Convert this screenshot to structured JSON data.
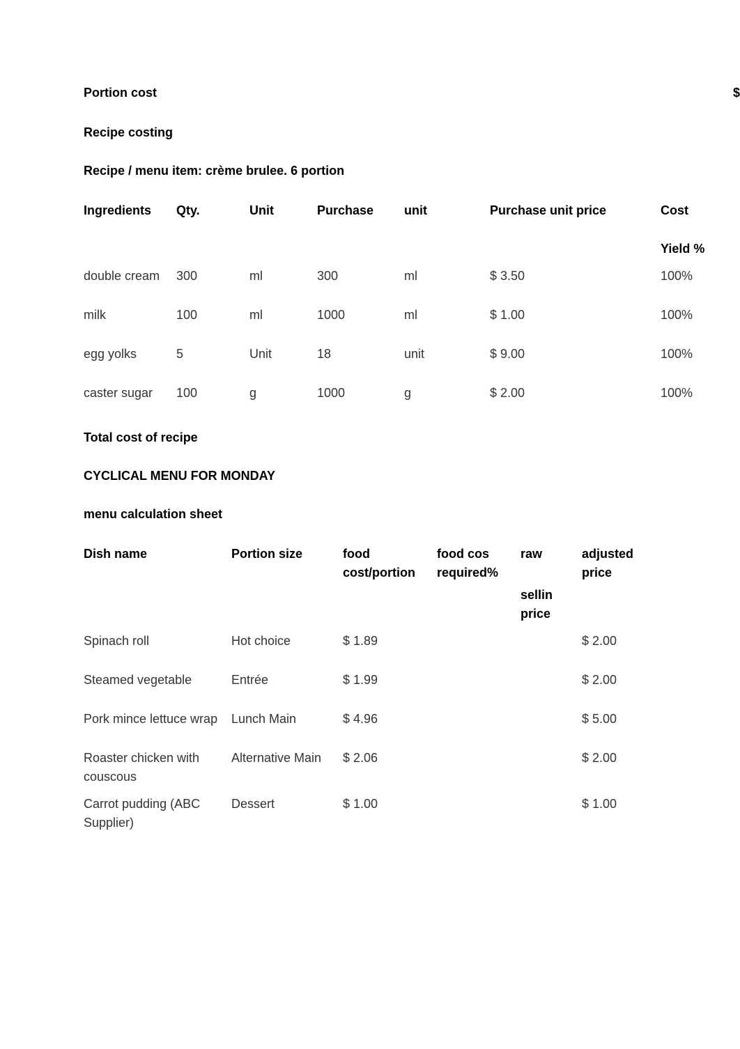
{
  "portion": {
    "label": "Portion cost",
    "value": "$"
  },
  "recipe": {
    "heading": "Recipe costing",
    "subtitle": "Recipe / menu item: crème brulee. 6 portion",
    "headers": {
      "ingredients": "Ingredients",
      "qty": "Qty.",
      "unit": "Unit",
      "purchase": "Purchase",
      "unit2": "unit",
      "purchase_unit_price": "Purchase unit price",
      "cost": "Cost",
      "yield": "Yield %"
    },
    "rows": [
      {
        "ing": "double cream",
        "qty": "300",
        "unit": "ml",
        "purchase": "300",
        "unit2": "ml",
        "price": "$ 3.50",
        "yield": "100%"
      },
      {
        "ing": "milk",
        "qty": "100",
        "unit": "ml",
        "purchase": "1000",
        "unit2": "ml",
        "price": "$ 1.00",
        "yield": "100%"
      },
      {
        "ing": "egg yolks",
        "qty": "5",
        "unit": "Unit",
        "purchase": "18",
        "unit2": "unit",
        "price": "$ 9.00",
        "yield": "100%"
      },
      {
        "ing": "caster sugar",
        "qty": "100",
        "unit": "g",
        "purchase": "1000",
        "unit2": "g",
        "price": "$ 2.00",
        "yield": "100%"
      }
    ],
    "total": "Total cost of recipe"
  },
  "menu": {
    "heading": "CYCLICAL MENU FOR MONDAY",
    "subtitle": "menu calculation sheet",
    "headers": {
      "dish": "Dish name",
      "portion": "Portion size",
      "food_cost": "food cost/portion",
      "food_cos_req": "food cos required%",
      "raw": "raw",
      "sellin": "sellin price",
      "adjusted": "adjusted price"
    },
    "rows": [
      {
        "dish": "Spinach roll",
        "portion": "Hot choice",
        "food": "$ 1.89",
        "adj": "$ 2.00"
      },
      {
        "dish": "Steamed vegetable",
        "portion": "Entrée",
        "food": "$ 1.99",
        "adj": "$ 2.00"
      },
      {
        "dish": "Pork mince lettuce wrap",
        "portion": "Lunch Main",
        "food": "$ 4.96",
        "adj": "$ 5.00"
      },
      {
        "dish": "Roaster chicken with couscous",
        "portion": "Alternative Main",
        "food": "$ 2.06",
        "adj": "$ 2.00"
      },
      {
        "dish": "Carrot pudding (ABC Supplier)",
        "portion": "Dessert",
        "food": "$ 1.00",
        "adj": "$ 1.00"
      }
    ]
  }
}
